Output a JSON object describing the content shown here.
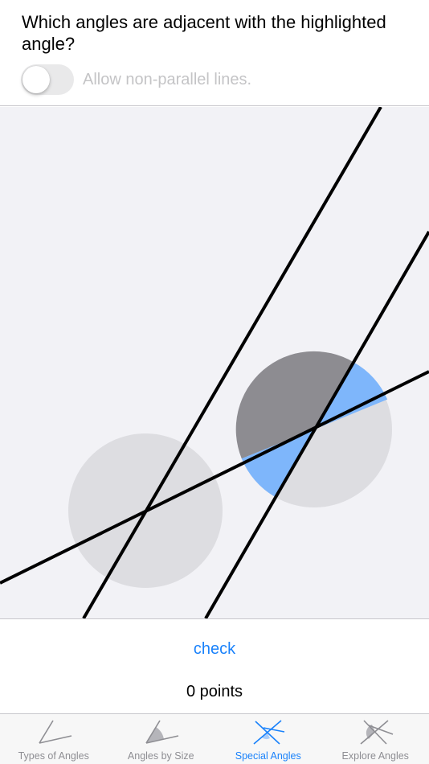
{
  "header": {
    "question": "Which angles are adjacent with the highlighted angle?",
    "toggle_label": "Allow non-parallel lines.",
    "toggle_on": false
  },
  "footer": {
    "check_label": "check",
    "points_text": "0 points"
  },
  "tabs": [
    {
      "label": "Types of Angles",
      "icon": "types-of-angles-icon",
      "active": false
    },
    {
      "label": "Angles by Size",
      "icon": "angles-by-size-icon",
      "active": false
    },
    {
      "label": "Special Angles",
      "icon": "special-angles-icon",
      "active": true
    },
    {
      "label": "Explore Angles",
      "icon": "explore-angles-icon",
      "active": false
    }
  ],
  "colors": {
    "accent": "#1a82fb",
    "highlight_angle": "#8d8c91",
    "adjacent_angle": "#7eb6fb",
    "intersection_disc": "#dddde1",
    "canvas_bg": "#f2f2f6"
  }
}
